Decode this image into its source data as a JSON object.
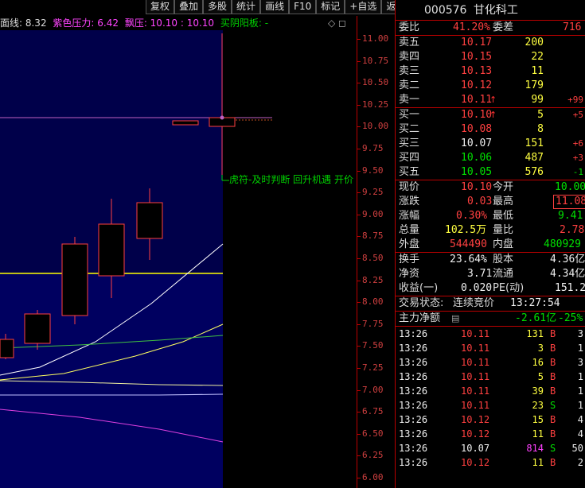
{
  "toolbar": {
    "buttons": [
      "复权",
      "叠加",
      "多股",
      "统计",
      "画线",
      "F10",
      "标记",
      "+自选",
      "返回"
    ]
  },
  "indicators": {
    "a": "面线: 8.32",
    "b": "紫色压力: 6.42",
    "c": "飘压: 10.10 : 10.10",
    "d": "买阴阳板: -",
    "icons": "◇ ◻"
  },
  "annotation": "虎符-及时判断 回升机遇 开价",
  "price_axis": [
    "11.00",
    "10.75",
    "10.50",
    "10.25",
    "10.00",
    "9.75",
    "9.50",
    "9.25",
    "9.00",
    "8.75",
    "8.50",
    "8.25",
    "8.00",
    "7.75",
    "7.50",
    "7.25",
    "7.00",
    "6.75",
    "6.50",
    "6.25",
    "6.00"
  ],
  "stock": {
    "code": "000576",
    "name": "甘化科工"
  },
  "order_ratio": {
    "label": "委比",
    "value": "41.20%",
    "diff_label": "委差",
    "diff": "716"
  },
  "asks": [
    {
      "label": "卖五",
      "price": "10.17",
      "vol": "200",
      "chg": ""
    },
    {
      "label": "卖四",
      "price": "10.15",
      "vol": "22",
      "chg": ""
    },
    {
      "label": "卖三",
      "price": "10.13",
      "vol": "11",
      "chg": ""
    },
    {
      "label": "卖二",
      "price": "10.12",
      "vol": "179",
      "chg": ""
    },
    {
      "label": "卖一",
      "price": "10.11",
      "vol": "99",
      "chg": "+99"
    }
  ],
  "bids": [
    {
      "label": "买一",
      "price": "10.10",
      "vol": "5",
      "chg": "+5"
    },
    {
      "label": "买二",
      "price": "10.08",
      "vol": "8",
      "chg": ""
    },
    {
      "label": "买三",
      "price": "10.07",
      "vol": "151",
      "chg": "+6"
    },
    {
      "label": "买四",
      "price": "10.06",
      "vol": "487",
      "chg": "+3"
    },
    {
      "label": "买五",
      "price": "10.05",
      "vol": "576",
      "chg": "-1"
    }
  ],
  "quote": {
    "now_label": "现价",
    "now": "10.10",
    "open_label": "今开",
    "open": "10.00",
    "chg_label": "涨跌",
    "chg": "0.03",
    "high_label": "最高",
    "high": "11.08",
    "pct_label": "涨幅",
    "pct": "0.30%",
    "low_label": "最低",
    "low": "9.41",
    "vol_label": "总量",
    "vol": "102.5万",
    "vr_label": "量比",
    "vr": "2.78",
    "outer_label": "外盘",
    "outer": "544490",
    "inner_label": "内盘",
    "inner": "480929"
  },
  "fund": {
    "turnover_label": "换手",
    "turnover": "23.64%",
    "equity_label": "股本",
    "equity": "4.36亿",
    "nav_label": "净资",
    "nav": "3.71",
    "float_label": "流通",
    "float": "4.34亿",
    "eps_label": "收益(一)",
    "eps": "0.020",
    "pe_label": "PE(动)",
    "pe": "151.2"
  },
  "status": {
    "label": "交易状态:",
    "value": "连续竞价",
    "time": "13:27:54"
  },
  "netflow": {
    "label": "主力净额",
    "value": "-2.61亿",
    "pct": "-25%"
  },
  "trades": [
    {
      "time": "13:26",
      "price": "10.11",
      "vol": "131",
      "side": "B",
      "n": "3"
    },
    {
      "time": "13:26",
      "price": "10.11",
      "vol": "3",
      "side": "B",
      "n": "1"
    },
    {
      "time": "13:26",
      "price": "10.11",
      "vol": "16",
      "side": "B",
      "n": "3"
    },
    {
      "time": "13:26",
      "price": "10.11",
      "vol": "5",
      "side": "B",
      "n": "1"
    },
    {
      "time": "13:26",
      "price": "10.11",
      "vol": "39",
      "side": "B",
      "n": "1"
    },
    {
      "time": "13:26",
      "price": "10.11",
      "vol": "23",
      "side": "S",
      "n": "1"
    },
    {
      "time": "13:26",
      "price": "10.12",
      "vol": "15",
      "side": "B",
      "n": "4"
    },
    {
      "time": "13:26",
      "price": "10.12",
      "vol": "11",
      "side": "B",
      "n": "4"
    },
    {
      "time": "13:26",
      "price": "10.07",
      "vol": "814",
      "side": "S",
      "n": "50"
    },
    {
      "time": "13:26",
      "price": "10.12",
      "vol": "11",
      "side": "B",
      "n": "2"
    }
  ]
}
